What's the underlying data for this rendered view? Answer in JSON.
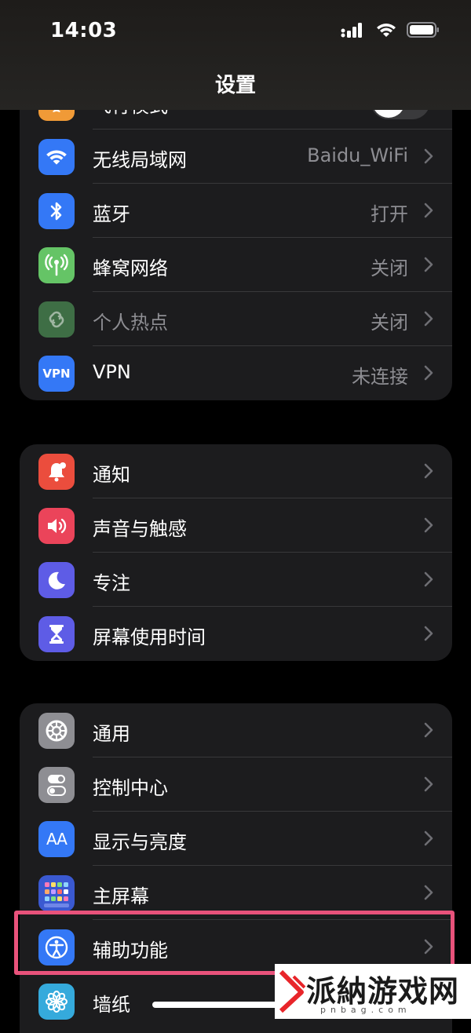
{
  "status_bar": {
    "time": "14:03"
  },
  "nav": {
    "title": "设置"
  },
  "groups": [
    {
      "items": [
        {
          "label": "飞行模式",
          "type": "toggle",
          "toggle_on": false,
          "icon": "airplane-icon",
          "icon_color": "#f09a37"
        },
        {
          "label": "无线局域网",
          "value": "Baidu_WiFi",
          "icon": "wifi-icon",
          "icon_color": "#3478f6"
        },
        {
          "label": "蓝牙",
          "value": "打开",
          "icon": "bluetooth-icon",
          "icon_color": "#3478f6"
        },
        {
          "label": "蜂窝网络",
          "value": "关闭",
          "icon": "cellular-antenna-icon",
          "icon_color": "#65c466"
        },
        {
          "label": "个人热点",
          "value": "关闭",
          "icon": "hotspot-link-icon",
          "icon_color": "#3e6e45",
          "disabled": true
        },
        {
          "label": "VPN",
          "value": "未连接",
          "icon": "vpn-icon",
          "icon_color": "#3478f6",
          "icon_text": "VPN"
        }
      ]
    },
    {
      "items": [
        {
          "label": "通知",
          "icon": "notification-bell-icon",
          "icon_color": "#eb4d3d"
        },
        {
          "label": "声音与触感",
          "icon": "speaker-icon",
          "icon_color": "#eb445a"
        },
        {
          "label": "专注",
          "icon": "moon-icon",
          "icon_color": "#5e5ce6"
        },
        {
          "label": "屏幕使用时间",
          "icon": "hourglass-icon",
          "icon_color": "#5e5ce6"
        }
      ]
    },
    {
      "items": [
        {
          "label": "通用",
          "icon": "gear-icon",
          "icon_color": "#8e8e93"
        },
        {
          "label": "控制中心",
          "icon": "toggles-icon",
          "icon_color": "#8e8e93"
        },
        {
          "label": "显示与亮度",
          "icon": "text-size-icon",
          "icon_color": "#3478f6",
          "icon_text": "AA"
        },
        {
          "label": "主屏幕",
          "icon": "home-screen-grid-icon",
          "icon_color": "#3a59d1"
        },
        {
          "label": "辅助功能",
          "icon": "accessibility-icon",
          "icon_color": "#3478f6"
        },
        {
          "label": "墙纸",
          "icon": "flower-icon",
          "icon_color": "#35aadc"
        }
      ]
    }
  ],
  "highlight_color": "#e8527b",
  "watermark": {
    "text": "派納游戏网",
    "sub": "pnbag.com"
  }
}
